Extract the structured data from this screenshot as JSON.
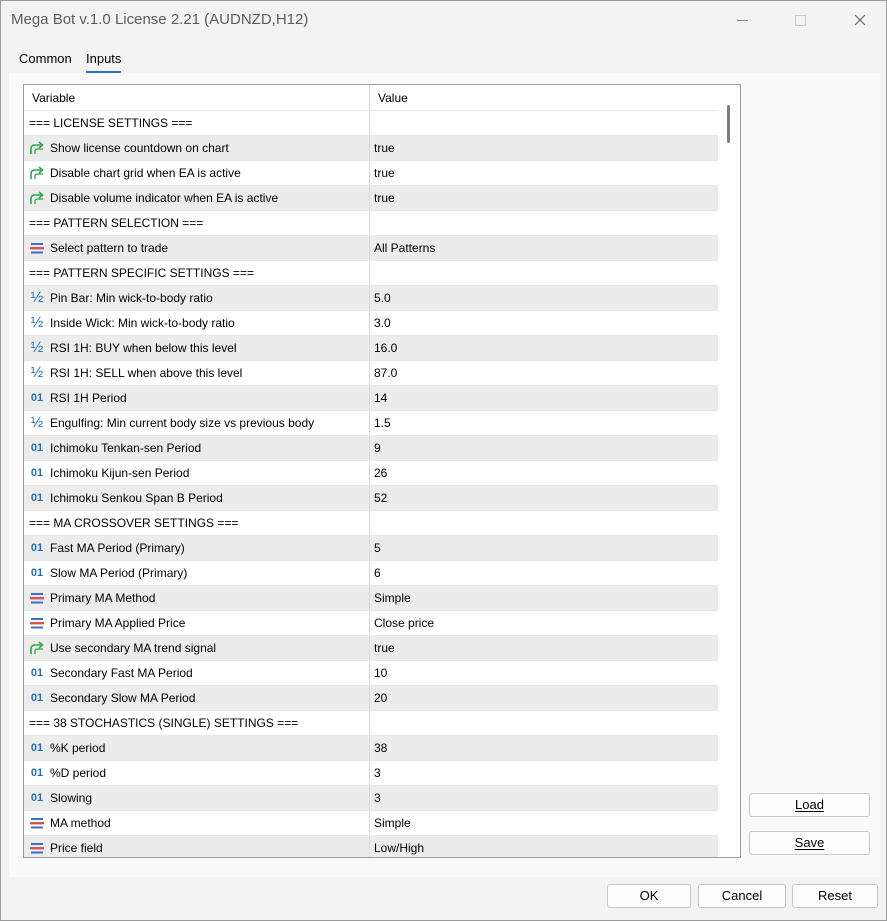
{
  "window": {
    "title": "Mega Bot v.1.0 License 2.21 (AUDNZD,H12)",
    "controls": {
      "minimize": "minimize-icon",
      "maximize": "maximize-icon",
      "close": "close-icon"
    }
  },
  "tabs": [
    {
      "label": "Common",
      "selected": false
    },
    {
      "label": "Inputs",
      "selected": true
    }
  ],
  "table": {
    "headers": {
      "variable": "Variable",
      "value": "Value"
    },
    "rows": [
      {
        "type": "section",
        "variable": "=== LICENSE SETTINGS ===",
        "value": ""
      },
      {
        "type": "bool",
        "variable": "Show license countdown on chart",
        "value": "true"
      },
      {
        "type": "bool",
        "variable": "Disable chart grid when EA is active",
        "value": "true"
      },
      {
        "type": "bool",
        "variable": "Disable volume indicator when EA is active",
        "value": "true"
      },
      {
        "type": "section",
        "variable": "=== PATTERN SELECTION ===",
        "value": ""
      },
      {
        "type": "enum",
        "variable": "Select pattern to trade",
        "value": "All Patterns"
      },
      {
        "type": "section",
        "variable": "=== PATTERN SPECIFIC SETTINGS ===",
        "value": ""
      },
      {
        "type": "double",
        "variable": "Pin Bar: Min wick-to-body ratio",
        "value": "5.0"
      },
      {
        "type": "double",
        "variable": "Inside Wick: Min wick-to-body ratio",
        "value": "3.0"
      },
      {
        "type": "double",
        "variable": "RSI 1H: BUY when below this level",
        "value": "16.0"
      },
      {
        "type": "double",
        "variable": "RSI 1H: SELL when above this level",
        "value": "87.0"
      },
      {
        "type": "int",
        "variable": "RSI 1H Period",
        "value": "14"
      },
      {
        "type": "double",
        "variable": "Engulfing: Min current body size vs previous body",
        "value": "1.5"
      },
      {
        "type": "int",
        "variable": "Ichimoku Tenkan-sen Period",
        "value": "9"
      },
      {
        "type": "int",
        "variable": "Ichimoku Kijun-sen Period",
        "value": "26"
      },
      {
        "type": "int",
        "variable": "Ichimoku Senkou Span B Period",
        "value": "52"
      },
      {
        "type": "section",
        "variable": "=== MA CROSSOVER SETTINGS ===",
        "value": ""
      },
      {
        "type": "int",
        "variable": "Fast MA Period (Primary)",
        "value": "5"
      },
      {
        "type": "int",
        "variable": "Slow MA Period (Primary)",
        "value": "6"
      },
      {
        "type": "enum",
        "variable": "Primary MA Method",
        "value": "Simple"
      },
      {
        "type": "enum",
        "variable": "Primary MA Applied Price",
        "value": "Close price"
      },
      {
        "type": "bool",
        "variable": "Use secondary MA trend signal",
        "value": "true"
      },
      {
        "type": "int",
        "variable": "Secondary Fast MA Period",
        "value": "10"
      },
      {
        "type": "int",
        "variable": "Secondary Slow MA Period",
        "value": "20"
      },
      {
        "type": "section",
        "variable": "=== 38 STOCHASTICS (SINGLE) SETTINGS ===",
        "value": ""
      },
      {
        "type": "int",
        "variable": "%K period",
        "value": "38"
      },
      {
        "type": "int",
        "variable": "%D period",
        "value": "3"
      },
      {
        "type": "int",
        "variable": "Slowing",
        "value": "3"
      },
      {
        "type": "enum",
        "variable": "MA method",
        "value": "Simple"
      },
      {
        "type": "enum",
        "variable": "Price field",
        "value": "Low/High"
      }
    ]
  },
  "icons": {
    "bool": "bool-arrow-icon",
    "enum": "enum-list-icon",
    "double": "half-fraction-icon",
    "int": "int-01-icon"
  },
  "icon_glyphs": {
    "double": "½",
    "int": "01"
  },
  "buttons": {
    "load": "Load",
    "save": "Save",
    "ok": "OK",
    "cancel": "Cancel",
    "reset": "Reset"
  },
  "colors": {
    "bool_icon": "#2aa84a",
    "enum_icon_red": "#d9534f",
    "enum_icon_blue": "#3a6fd1",
    "numeric_icon": "#1e6fbf",
    "tab_underline": "#2f6fc9"
  }
}
